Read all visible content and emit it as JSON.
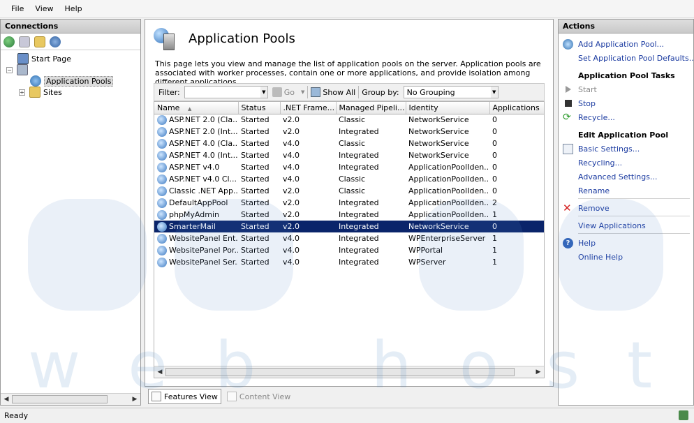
{
  "menu": [
    "File",
    "View",
    "Help"
  ],
  "connections": {
    "title": "Connections",
    "tree": [
      {
        "label": "Start Page"
      },
      {
        "label": ""
      },
      {
        "label": "Application Pools"
      },
      {
        "label": "Sites"
      }
    ]
  },
  "main": {
    "title": "Application Pools",
    "description": "This page lets you view and manage the list of application pools on the server. Application pools are associated with worker processes, contain one or more applications, and provide isolation among different applications.",
    "filter_label": "Filter:",
    "filter_value": "",
    "go_label": "Go",
    "show_all_label": "Show All",
    "group_by_label": "Group by:",
    "group_by_value": "No Grouping",
    "columns": [
      "Name",
      "Status",
      ".NET Frame...",
      "Managed Pipeli...",
      "Identity",
      "Applications"
    ],
    "rows": [
      {
        "name": "ASP.NET 2.0 (Cla...",
        "status": "Started",
        "net": "v2.0",
        "pipeline": "Classic",
        "identity": "NetworkService",
        "apps": "0"
      },
      {
        "name": "ASP.NET 2.0 (Int...",
        "status": "Started",
        "net": "v2.0",
        "pipeline": "Integrated",
        "identity": "NetworkService",
        "apps": "0"
      },
      {
        "name": "ASP.NET 4.0 (Cla...",
        "status": "Started",
        "net": "v4.0",
        "pipeline": "Classic",
        "identity": "NetworkService",
        "apps": "0"
      },
      {
        "name": "ASP.NET 4.0 (Int...",
        "status": "Started",
        "net": "v4.0",
        "pipeline": "Integrated",
        "identity": "NetworkService",
        "apps": "0"
      },
      {
        "name": "ASP.NET v4.0",
        "status": "Started",
        "net": "v4.0",
        "pipeline": "Integrated",
        "identity": "ApplicationPoolIden...",
        "apps": "0"
      },
      {
        "name": "ASP.NET v4.0 Cl...",
        "status": "Started",
        "net": "v4.0",
        "pipeline": "Classic",
        "identity": "ApplicationPoolIden...",
        "apps": "0"
      },
      {
        "name": "Classic .NET App...",
        "status": "Started",
        "net": "v2.0",
        "pipeline": "Classic",
        "identity": "ApplicationPoolIden...",
        "apps": "0"
      },
      {
        "name": "DefaultAppPool",
        "status": "Started",
        "net": "v2.0",
        "pipeline": "Integrated",
        "identity": "ApplicationPoolIden...",
        "apps": "2"
      },
      {
        "name": "phpMyAdmin",
        "status": "Started",
        "net": "v2.0",
        "pipeline": "Integrated",
        "identity": "ApplicationPoolIden...",
        "apps": "1"
      },
      {
        "name": "SmarterMail",
        "status": "Started",
        "net": "v2.0",
        "pipeline": "Integrated",
        "identity": "NetworkService",
        "apps": "0",
        "selected": true
      },
      {
        "name": "WebsitePanel Ent...",
        "status": "Started",
        "net": "v4.0",
        "pipeline": "Integrated",
        "identity": "WPEnterpriseServer",
        "apps": "1"
      },
      {
        "name": "WebsitePanel Por...",
        "status": "Started",
        "net": "v4.0",
        "pipeline": "Integrated",
        "identity": "WPPortal",
        "apps": "1"
      },
      {
        "name": "WebsitePanel Ser...",
        "status": "Started",
        "net": "v4.0",
        "pipeline": "Integrated",
        "identity": "WPServer",
        "apps": "1"
      }
    ],
    "view_tabs": [
      "Features View",
      "Content View"
    ]
  },
  "actions": {
    "title": "Actions",
    "add_pool": "Add Application Pool...",
    "set_defaults": "Set Application Pool Defaults...",
    "tasks_header": "Application Pool Tasks",
    "start": "Start",
    "stop": "Stop",
    "recycle": "Recycle...",
    "edit_header": "Edit Application Pool",
    "basic_settings": "Basic Settings...",
    "recycling": "Recycling...",
    "advanced_settings": "Advanced Settings...",
    "rename": "Rename",
    "remove": "Remove",
    "view_apps": "View Applications",
    "help": "Help",
    "online_help": "Online Help"
  },
  "status": "Ready",
  "watermark": {
    "text": "web hosting"
  },
  "colors": {
    "selection": "#0a246a",
    "link": "#1a3aa0",
    "remove": "#d42020"
  }
}
